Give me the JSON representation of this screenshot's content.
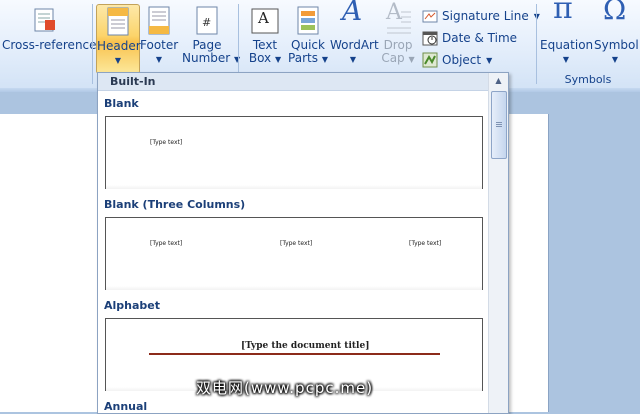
{
  "ribbon": {
    "cross_reference_label": "Cross-reference",
    "header": {
      "label": "Header"
    },
    "footer": {
      "label": "Footer"
    },
    "page_number": {
      "line1": "Page",
      "line2": "Number"
    },
    "text_box": {
      "line1": "Text",
      "line2": "Box"
    },
    "quick_parts": {
      "line1": "Quick",
      "line2": "Parts"
    },
    "wordart": {
      "label": "WordArt"
    },
    "drop_cap": {
      "line1": "Drop",
      "line2": "Cap"
    },
    "signature_line": "Signature Line",
    "date_time": "Date & Time",
    "object": "Object",
    "equation": {
      "label": "Equation"
    },
    "symbol": {
      "label": "Symbol"
    },
    "symbols_group_label": "Symbols",
    "pi_glyph": "π",
    "omega_glyph": "Ω",
    "wordart_glyph": "A",
    "page_hash": "#"
  },
  "gallery": {
    "heading": "Built-In",
    "sections": [
      {
        "title": "Blank",
        "placeholders": [
          "[Type text]"
        ]
      },
      {
        "title": "Blank (Three Columns)",
        "placeholders": [
          "[Type text]",
          "[Type text]",
          "[Type text]"
        ]
      },
      {
        "title": "Alphabet",
        "placeholders": [
          "[Type the document title]"
        ]
      },
      {
        "title": "Annual"
      }
    ]
  },
  "watermark": "双电网(www.pcpc.me)",
  "colors": {
    "ribbon_text": "#15428b",
    "header_highlight": "#fcd46b",
    "alphabet_rule": "#8c2b1a"
  }
}
